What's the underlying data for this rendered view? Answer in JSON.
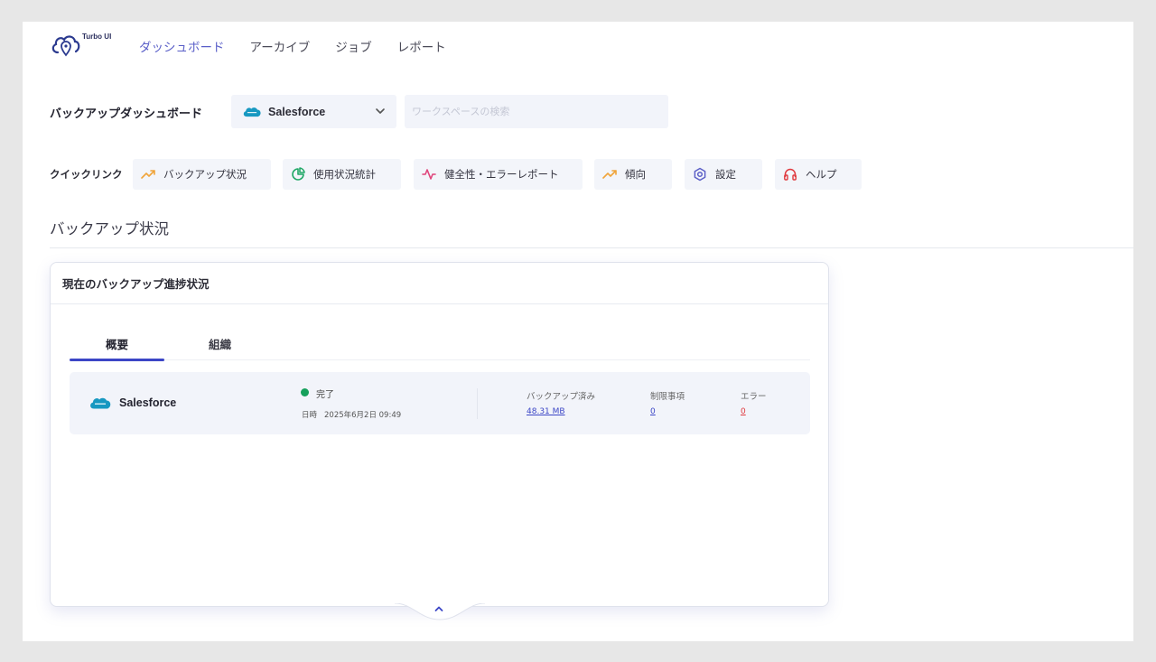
{
  "brand": {
    "name": "Turbo UI"
  },
  "nav": {
    "items": [
      {
        "label": "ダッシュボード",
        "active": true
      },
      {
        "label": "アーカイブ",
        "active": false
      },
      {
        "label": "ジョブ",
        "active": false
      },
      {
        "label": "レポート",
        "active": false
      }
    ]
  },
  "header": {
    "title": "バックアップダッシュボード",
    "org_select": {
      "value": "Salesforce"
    },
    "search": {
      "placeholder": "ワークスペースの検索"
    }
  },
  "quick_links": {
    "label": "クイックリンク",
    "items": [
      {
        "label": "バックアップ状況",
        "icon": "trending-up-icon"
      },
      {
        "label": "使用状況統計",
        "icon": "pie-chart-icon"
      },
      {
        "label": "健全性・エラーレポート",
        "icon": "activity-icon"
      },
      {
        "label": "傾向",
        "icon": "trending-up-icon"
      },
      {
        "label": "設定",
        "icon": "gear-icon"
      },
      {
        "label": "ヘルプ",
        "icon": "headphones-icon"
      }
    ]
  },
  "section": {
    "title": "バックアップ状況"
  },
  "card": {
    "title": "現在のバックアップ進捗状況",
    "tabs": [
      {
        "label": "概要",
        "active": true
      },
      {
        "label": "組織",
        "active": false
      }
    ],
    "rows": [
      {
        "org": "Salesforce",
        "status": "完了",
        "date_label": "日時",
        "date": "2025年6月2日 09:49",
        "metrics": [
          {
            "label": "バックアップ済み",
            "value": "48.31 MB",
            "tone": "blue"
          },
          {
            "label": "制限事項",
            "value": "0",
            "tone": "blue"
          },
          {
            "label": "エラー",
            "value": "0",
            "tone": "red"
          }
        ]
      }
    ]
  },
  "colors": {
    "accent": "#3c46c6",
    "nav_active": "#5a5fc8",
    "success": "#16a05c",
    "error": "#e0393e",
    "salesforce": "#1798c1",
    "trend": "#f0a43a",
    "pie": "#21a867",
    "health": "#e0457b",
    "settings": "#5b5fc7",
    "help": "#e0393e"
  }
}
